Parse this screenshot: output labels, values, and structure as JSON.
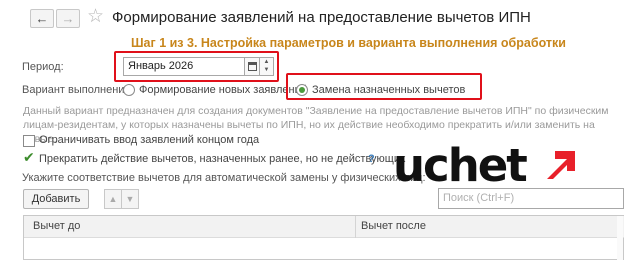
{
  "window": {
    "title": "Формирование заявлений на предоставление вычетов ИПН",
    "back_glyph": "←",
    "forward_glyph": "→",
    "favorite_icon": "star-icon"
  },
  "step": {
    "text": "Шаг 1 из 3. Настройка параметров и варианта выполнения обработки"
  },
  "period": {
    "label": "Период:",
    "value": "Январь 2026"
  },
  "variant": {
    "label": "Вариант выполнения:",
    "options": [
      {
        "label": "Формирование новых заявлений",
        "selected": false
      },
      {
        "label": "Замена назначенных вычетов",
        "selected": true
      }
    ]
  },
  "description": {
    "line1": "Данный вариант предназначен для создания документов \"Заявление на предоставление вычетов ИПН\" по физическим",
    "line2": "лицам-резидентам, у которых назначены вычеты по ИПН, но их действие необходимо прекратить и/или заменить на новые."
  },
  "options": {
    "limit_label": "Ограничивать ввод заявлений концом года",
    "limit_checked": false,
    "terminate_label": "Прекратить действие вычетов, назначенных ранее, но не действующих",
    "terminate_checked": true,
    "help_glyph": "?"
  },
  "mapping": {
    "label": "Укажите соответствие вычетов для автоматической замены у физических лиц:"
  },
  "toolbar": {
    "add_label": "Добавить",
    "search_placeholder": "Поиск (Ctrl+F)"
  },
  "table": {
    "columns": [
      "Вычет до",
      "Вычет после"
    ]
  },
  "watermark": {
    "text": "uchet",
    "accent_color": "#e8202a"
  },
  "colors": {
    "step_text": "#c8861b",
    "highlight": "#e0101a",
    "selected_radio": "#4a9a3c",
    "checkmark": "#3c8c2c"
  }
}
